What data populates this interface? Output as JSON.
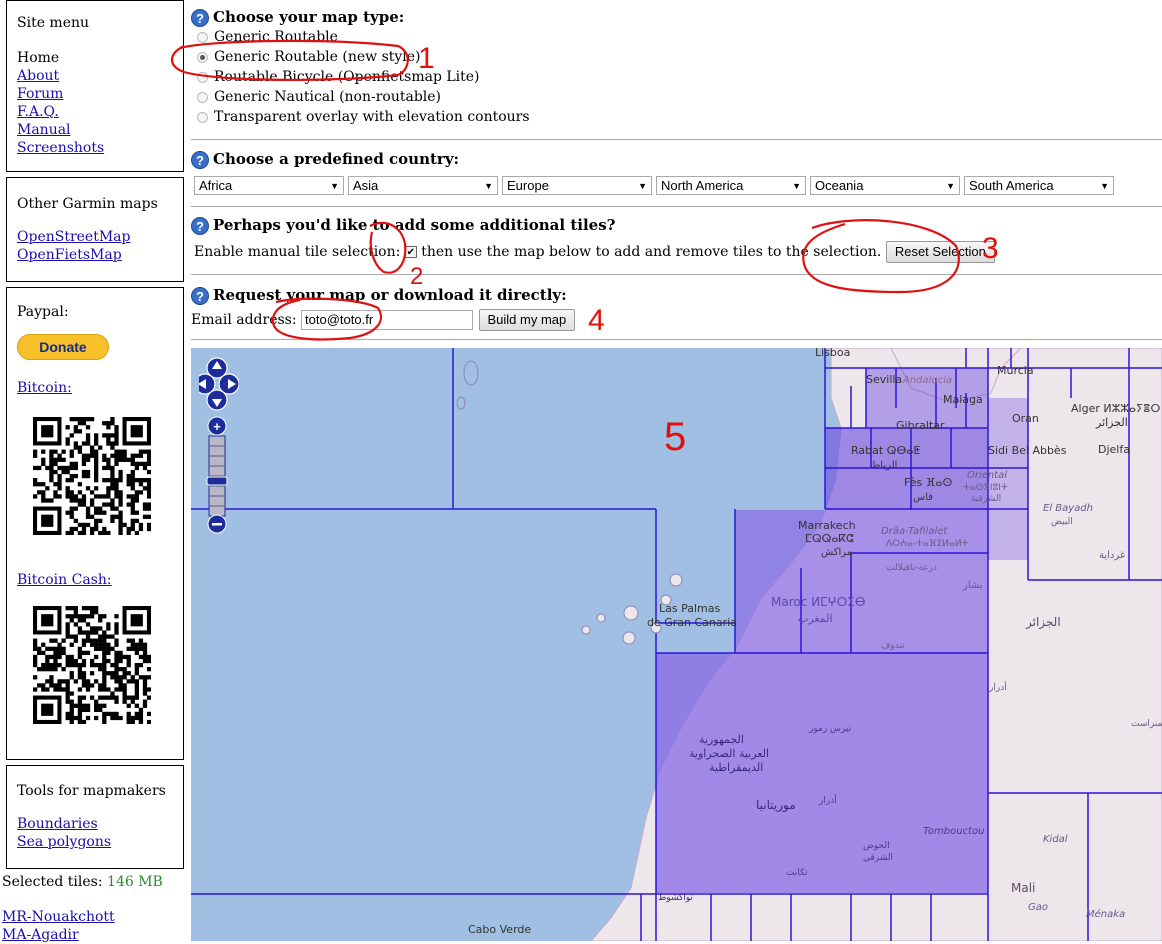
{
  "site_menu": {
    "title": "Site menu",
    "home": "Home",
    "links": [
      "About",
      "Forum",
      "F.A.Q.",
      "Manual",
      "Screenshots"
    ]
  },
  "other_maps": {
    "title": "Other Garmin maps",
    "links": [
      "OpenStreetMap",
      "OpenFietsMap"
    ]
  },
  "donate_panel": {
    "paypal_label": "Paypal:",
    "donate_button": "Donate",
    "bitcoin_label": "Bitcoin:",
    "bitcoin_cash_label": "Bitcoin Cash:"
  },
  "tools": {
    "title": "Tools for mapmakers",
    "links": [
      "Boundaries",
      "Sea polygons"
    ]
  },
  "selected": {
    "label": "Selected tiles:",
    "size": "146 MB",
    "tiles": [
      "MR-Nouakchott",
      "MA-Agadir"
    ]
  },
  "map_type": {
    "heading": "Choose your map type:",
    "options": [
      "Generic Routable",
      "Generic Routable (new style)",
      "Routable Bicycle (Openfietsmap Lite)",
      "Generic Nautical (non-routable)",
      "Transparent overlay with elevation contours"
    ],
    "selected_index": 1
  },
  "country": {
    "heading": "Choose a predefined country:",
    "dropdowns": [
      "Africa",
      "Asia",
      "Europe",
      "North America",
      "Oceania",
      "South America"
    ]
  },
  "tiles": {
    "heading": "Perhaps you'd like to add some additional tiles?",
    "enable_label": "Enable manual tile selection:",
    "after_text": "then use the map below to add and remove tiles to the selection.",
    "reset_button": "Reset Selection",
    "checked": true
  },
  "request": {
    "heading": "Request your map or download it directly:",
    "email_label": "Email address:",
    "email_value": "toto@toto.fr",
    "build_button": "Build my map"
  },
  "annotations": [
    "1",
    "2",
    "3",
    "4",
    "5"
  ],
  "map_labels": {
    "lisboa": "Lisboa",
    "sevilla": "Sevilla",
    "andalucia": "Andalucía",
    "malaga": "Malaga",
    "murcia": "Murcia",
    "gibraltar": "Gibraltar",
    "oran": "Oran",
    "alger": "Alger ⵍⵣⵣⴰⵢⴻⵔ",
    "alger_ar": "الجزائر",
    "rabat": "Rabat ⵕⴱⴰⵟ",
    "rabat_ar": "الرباط",
    "sidi": "Sidi Bel Abbès",
    "djelfa": "Djelfa",
    "fes": "Fès ⴼⴰⵙ",
    "fes_ar": "فاس",
    "oriental": "Oriental",
    "oriental_tz": "ⵜⴰⵙⴳⵏⵓⵏⵜ",
    "oriental_ar": "الشرقية",
    "elbayadh": "El Bayadh",
    "elbayadh_ar": "البيض",
    "ghardaia": "غرداية",
    "marrakech": "Marrakech",
    "marrakech_tz": "ⵎⵕⵕⴰⴽⵛ",
    "marrakech_ar": "مراكش",
    "draa": "Drâa-Tafilalet",
    "draa_tz": "ⴷⵔⵄⴰ-ⵜⴰⴼⵉⵍⴰⵍⵜ",
    "draa_ar": "درعة-تافيلالت",
    "bechar": "بشار",
    "maroc": "Maroc ⵍⵎⵖⵔⵉⴱ",
    "maghrib_ar": "المغرب",
    "algeria_ar": "الجزائر",
    "tindouf": "تندوف",
    "laspalmas": "Las Palmas",
    "grancanaria": "de Gran Canaria",
    "adrar": "أدرار",
    "tamanrasset": "تمنراست",
    "zemmour": "تيرس زمور",
    "sahrawi1": "الجمهورية",
    "sahrawi2": "العربية الصحراوية",
    "sahrawi3": "الديمقراطية",
    "adrar2": "أدرار",
    "mauritania": "موريتانيا",
    "hodh1": "الحوض",
    "hodh2": "الشرقي",
    "tombouctou": "Tombouctou",
    "kidal": "Kidal",
    "takant": "تكانت",
    "nouakchott": "نواكشوط",
    "mali": "Mali",
    "gao": "Gao",
    "menaka": "Ménaka",
    "caboverde": "Cabo Verde"
  },
  "colors": {
    "sea": "#a0bfe2",
    "land": "#ede6ea",
    "selected_tile": "#9d80ea",
    "tile_border": "#2b16d8",
    "annotation": "#e01010"
  }
}
